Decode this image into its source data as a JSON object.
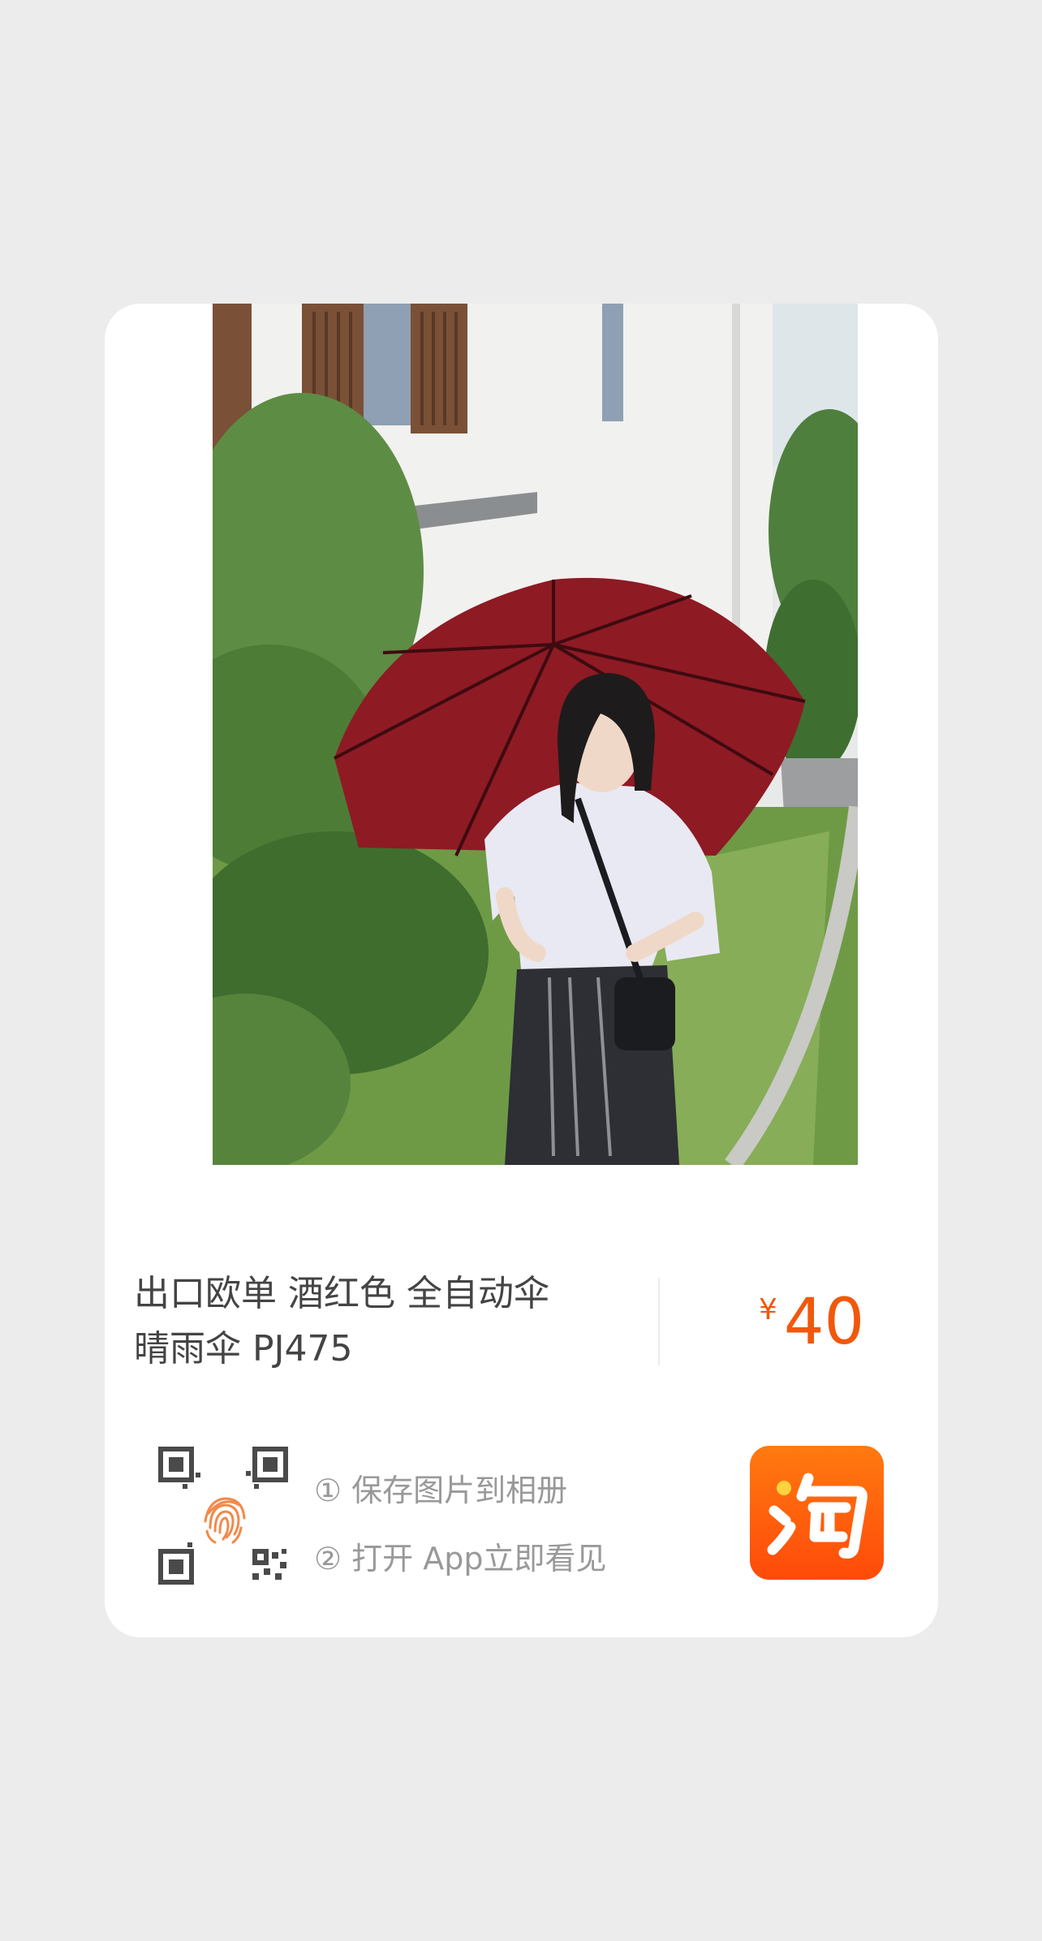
{
  "product": {
    "title_line1": "出口欧单 酒红色 全自动伞",
    "title_line2": "晴雨伞 PJ475",
    "currency": "¥",
    "price": "40"
  },
  "instructions": {
    "step1": "① 保存图片到相册",
    "step2": "② 打开 App立即看见"
  },
  "icons": {
    "photo": "product-photo",
    "scan": "qr-fingerprint-icon",
    "app": "taobao-logo-icon"
  },
  "colors": {
    "page_background": "#ececec",
    "card_background": "#ffffff",
    "price_accent": "#f1580c",
    "logo_gradient_top": "#ff7a10",
    "logo_gradient_bottom": "#ff4a0a",
    "umbrella": "#8e1a24"
  }
}
